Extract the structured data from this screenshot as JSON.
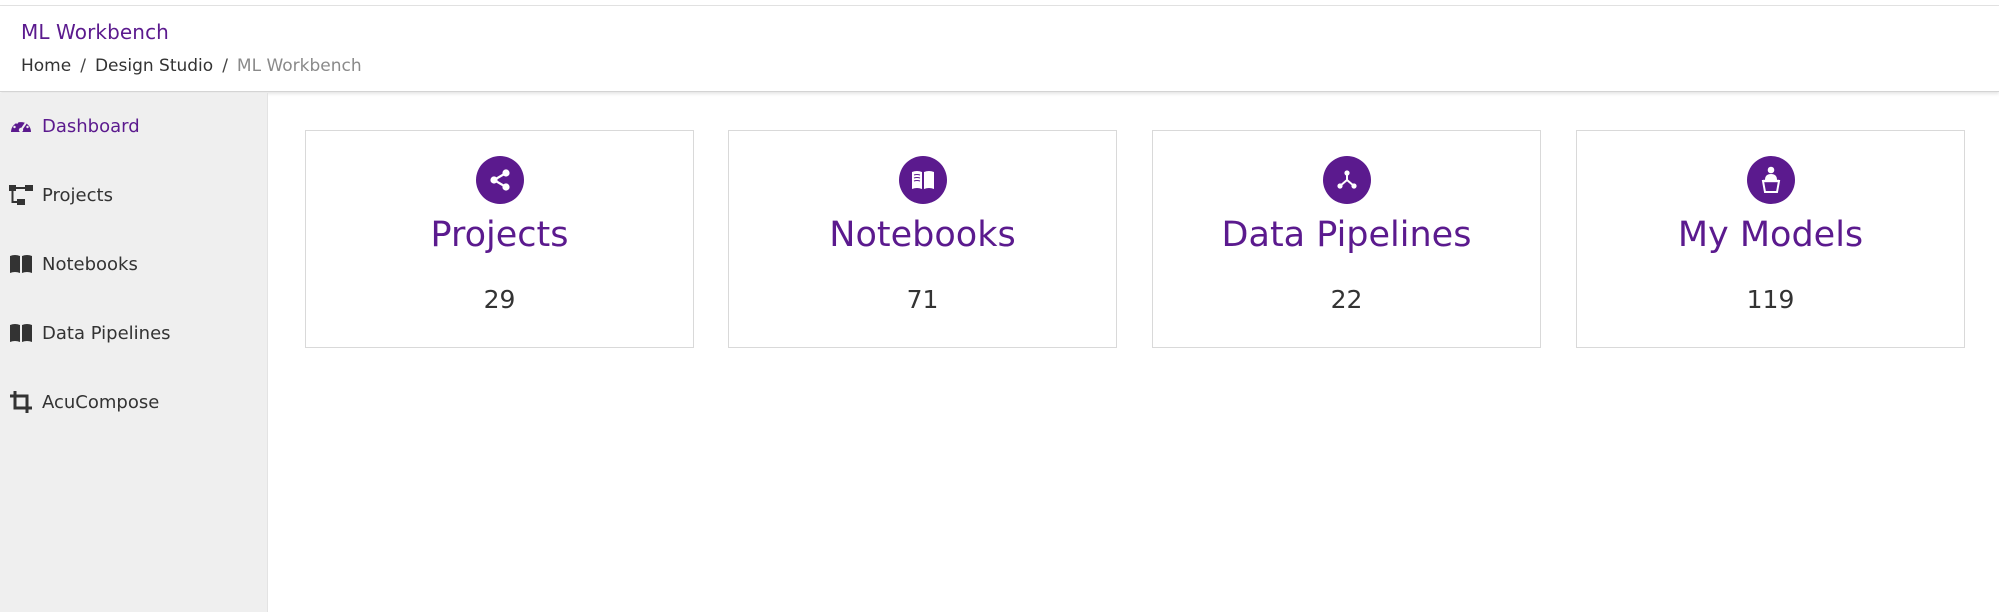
{
  "app": {
    "title": "ML Workbench"
  },
  "breadcrumb": {
    "items": [
      "Home",
      "Design Studio",
      "ML Workbench"
    ],
    "separator": "/"
  },
  "sidebar": {
    "items": [
      {
        "label": "Dashboard",
        "icon": "gauge-icon",
        "active": true
      },
      {
        "label": "Projects",
        "icon": "hierarchy-icon",
        "active": false
      },
      {
        "label": "Notebooks",
        "icon": "book-icon",
        "active": false
      },
      {
        "label": "Data Pipelines",
        "icon": "book-icon",
        "active": false
      },
      {
        "label": "AcuCompose",
        "icon": "crop-icon",
        "active": false
      }
    ]
  },
  "cards": [
    {
      "title": "Projects",
      "count": "29",
      "icon": "share-icon"
    },
    {
      "title": "Notebooks",
      "count": "71",
      "icon": "open-book-icon"
    },
    {
      "title": "Data Pipelines",
      "count": "22",
      "icon": "branch-icon"
    },
    {
      "title": "My Models",
      "count": "119",
      "icon": "presenter-icon"
    }
  ],
  "colors": {
    "accent": "#5b1a8e",
    "sidebar_bg": "#efefef",
    "text": "#333333",
    "muted": "#8a8a8a"
  }
}
